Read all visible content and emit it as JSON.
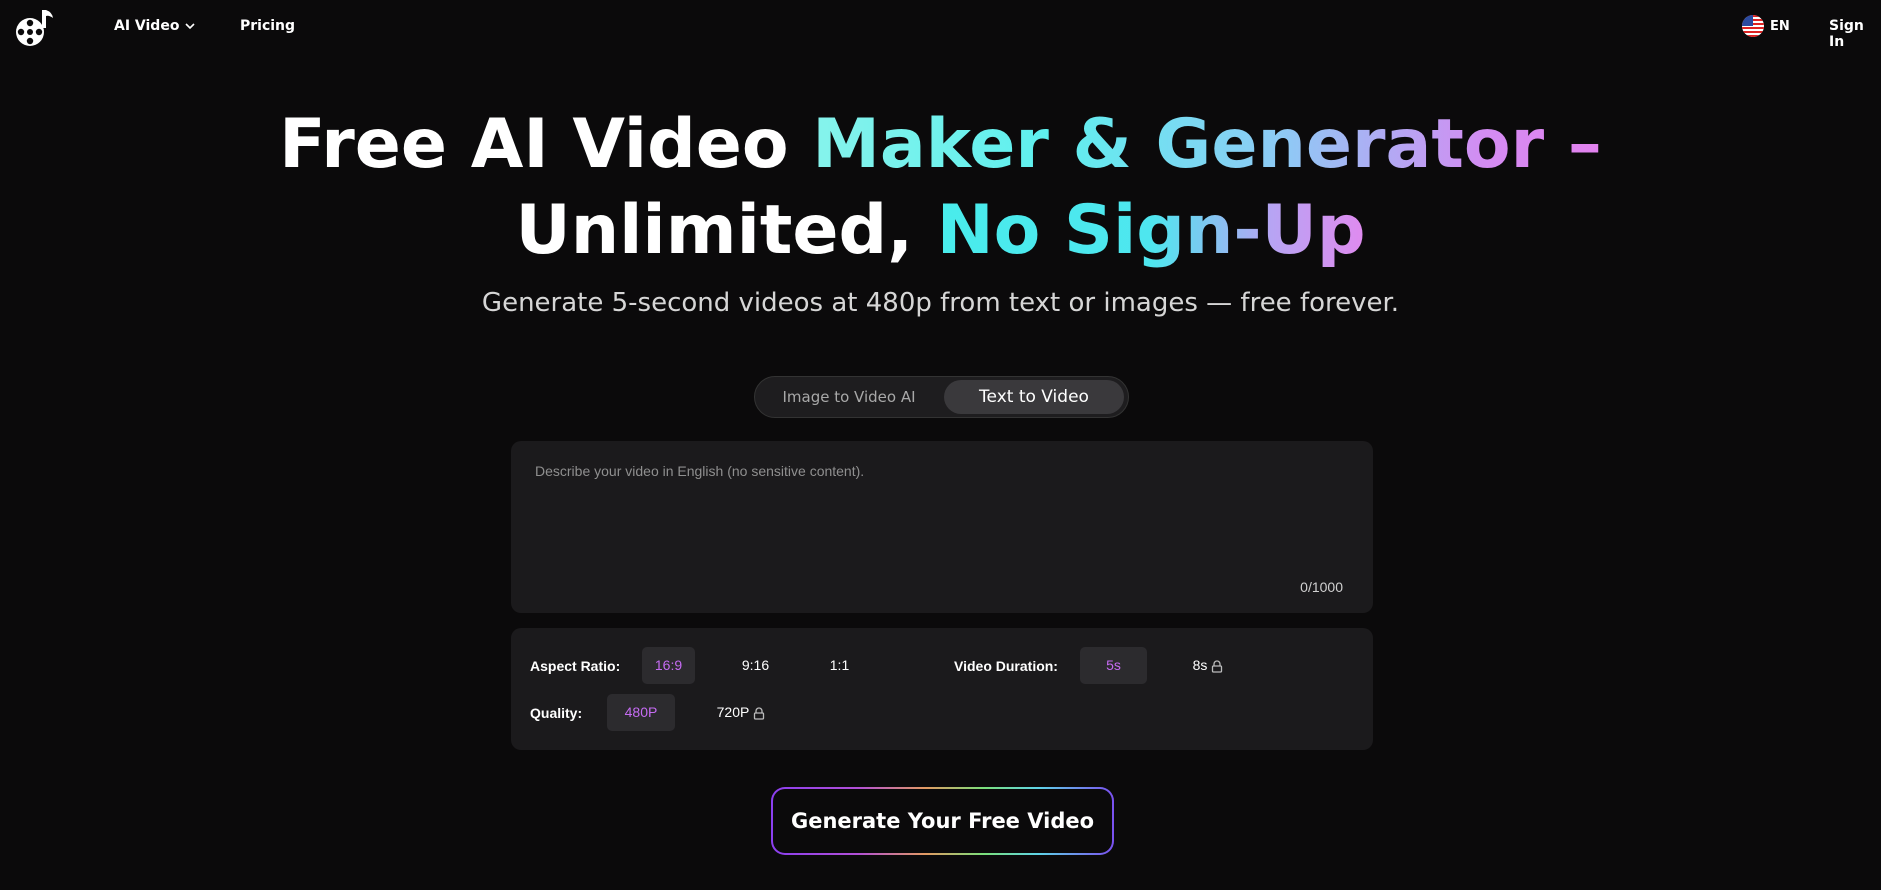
{
  "nav": {
    "ai_video_label": "AI Video",
    "pricing_label": "Pricing",
    "language_label": "EN",
    "signin_label": "Sign In"
  },
  "hero": {
    "title_part1": "Free AI Video ",
    "title_part2": "Maker & Generator –",
    "title_part3": "Unlimited, ",
    "title_part4": "No Sign-Up",
    "subtitle": "Generate 5-second videos at 480p from text or images — free forever."
  },
  "tabs": {
    "image_to_video": "Image to Video AI",
    "text_to_video": "Text to Video",
    "active": "Text to Video"
  },
  "prompt": {
    "placeholder": "Describe your video in English (no sensitive content).",
    "value": "",
    "counter": "0/1000"
  },
  "settings": {
    "aspect_ratio_label": "Aspect Ratio:",
    "aspect_options": [
      "16:9",
      "9:16",
      "1:1"
    ],
    "aspect_selected": "16:9",
    "duration_label": "Video Duration:",
    "duration_options": [
      "5s",
      "8s"
    ],
    "duration_selected": "5s",
    "quality_label": "Quality:",
    "quality_options": [
      "480P",
      "720P"
    ],
    "quality_selected": "480P"
  },
  "generate": {
    "label": "Generate Your Free Video"
  },
  "colors": {
    "background": "#0b0a0b",
    "panel": "#1b1a1c",
    "accent_purple": "#c56bf2",
    "accent_cyan": "#4ee6ef"
  },
  "icons": [
    "app-logo-icon",
    "chevron-down-icon",
    "us-flag-icon",
    "lock-icon"
  ]
}
